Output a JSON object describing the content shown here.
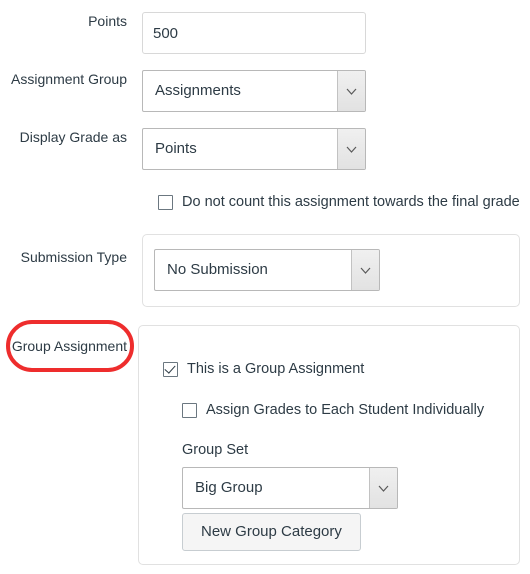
{
  "form": {
    "rows": [
      {
        "label": "Points",
        "type": "text",
        "value": "500"
      },
      {
        "label": "Assignment Group",
        "type": "select",
        "value": "Assignments"
      },
      {
        "label": "Display Grade as",
        "type": "select",
        "value": "Points"
      },
      {
        "label": "Submission Type",
        "type": "select",
        "value": "No Submission"
      },
      {
        "label": "Group Assignment",
        "type": "panel",
        "value": ""
      }
    ],
    "checkboxes": {
      "do_not_count": {
        "label": "Do not count this assignment towards the final grade",
        "checked": false
      },
      "is_group_assignment": {
        "label": "This is a Group Assignment",
        "checked": true
      },
      "assign_grades_individually": {
        "label": "Assign Grades to Each Student Individually",
        "checked": false
      }
    },
    "group_set": {
      "label": "Group Set",
      "value": "Big Group",
      "new_category_button": "New Group Category"
    }
  },
  "annotation": {
    "target": "Group Assignment",
    "color": "#ee2d2d",
    "shape": "rounded-oval"
  },
  "icons": {
    "dropdown": "chevron-down-icon"
  },
  "colors": {
    "text": "#2d3b45",
    "input_border": "#d8d8d8",
    "select_border": "#b8b8b8",
    "panel_border": "#e1e1e1",
    "button_bg": "#f5f5f5",
    "annotation_red": "#ee2d2d"
  }
}
